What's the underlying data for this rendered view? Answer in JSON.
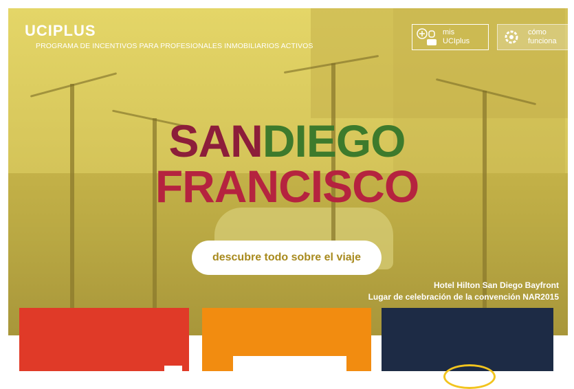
{
  "brand": {
    "logo_text": "UCIPLUS",
    "tagline": "PROGRAMA DE INCENTIVOS PARA PROFESIONALES INMOBILIARIOS ACTIVOS"
  },
  "header": {
    "mis_line1": "mis",
    "mis_line2": "UCIplus",
    "como_line1": "cómo",
    "como_line2": "funciona"
  },
  "hero": {
    "title_word_1": "SAN",
    "title_word_2": "DIEGO",
    "title_line_2": "FRANCISCO",
    "cta_label": "descubre todo sobre el viaje",
    "caption_line_1": "Hotel Hilton San Diego Bayfront",
    "caption_line_2": "Lugar de celebración de la convención NAR2015"
  },
  "colors": {
    "hero_tint": "#d4c457",
    "cta_text": "#a88a1e",
    "card_red": "#e03a28",
    "card_orange": "#f28c10",
    "card_navy": "#1d2b45"
  },
  "icons": {
    "mis": "user-plus-icon",
    "como": "gear-icon"
  }
}
